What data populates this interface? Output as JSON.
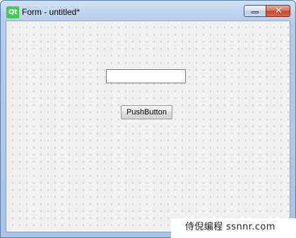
{
  "window": {
    "title": "Form - untitled*",
    "logo_text": "Qt",
    "close_glyph": "✕"
  },
  "form": {
    "line_edit_value": "",
    "push_button_label": "PushButton"
  },
  "watermark": {
    "text": "侍倪编程 ssnnr.com"
  },
  "icons": {
    "app": "qt-logo-icon",
    "minimize": "minimize-icon",
    "close": "close-icon"
  },
  "colors": {
    "qt_green": "#41cd52",
    "close_red": "#c4432c",
    "titlebar_blue": "#bcd3ec"
  }
}
